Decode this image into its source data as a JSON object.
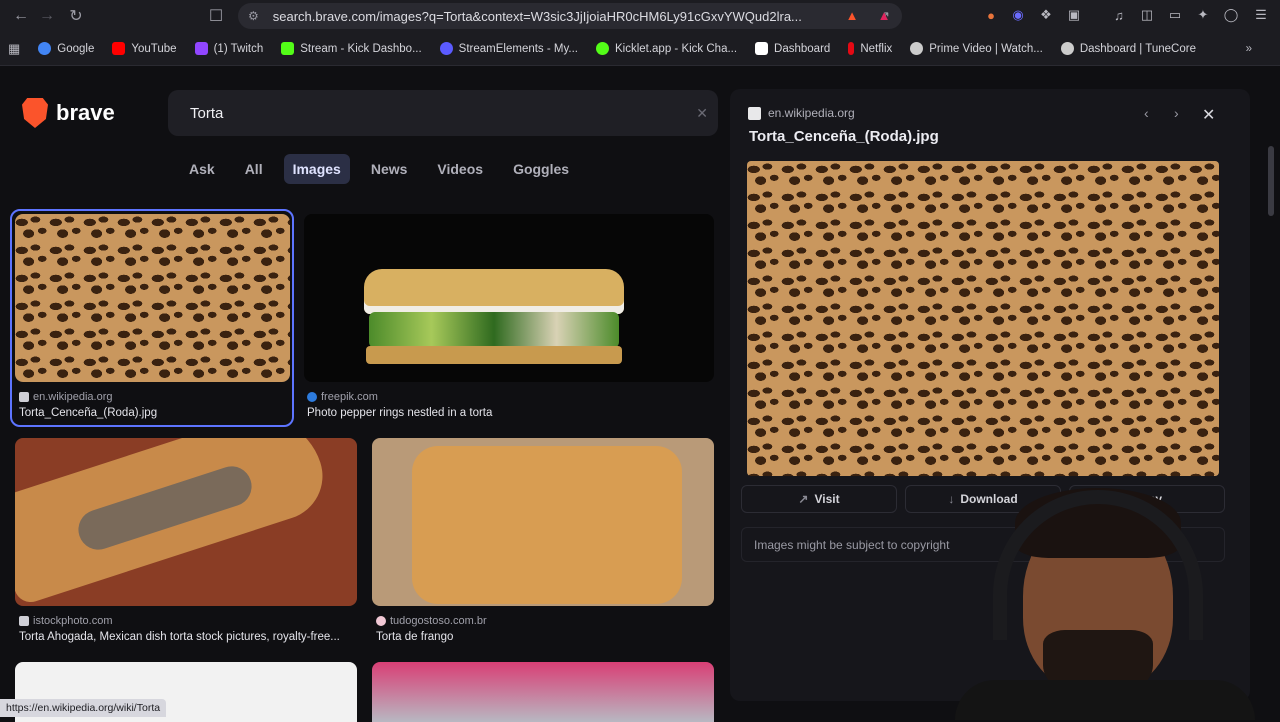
{
  "browser": {
    "url": "search.brave.com/images?q=Torta&context=W3sic3JjIjoiaHR0cHM6Ly91cGxvYWQud2lra...",
    "bookmarks": [
      {
        "label": "Google",
        "color": "#4285f4"
      },
      {
        "label": "YouTube",
        "color": "#ff0000"
      },
      {
        "label": "(1) Twitch",
        "color": "#9146ff"
      },
      {
        "label": "Stream - Kick Dashbo...",
        "color": "#53fc18"
      },
      {
        "label": "StreamElements - My...",
        "color": "#5b5bff"
      },
      {
        "label": "Kicklet.app - Kick Cha...",
        "color": "#53fc18"
      },
      {
        "label": "Dashboard",
        "color": "#ffffff"
      },
      {
        "label": "Netflix",
        "color": "#e50914"
      },
      {
        "label": "Prime Video | Watch...",
        "color": "#cccccc"
      },
      {
        "label": "Dashboard | TuneCore",
        "color": "#cccccc"
      }
    ]
  },
  "brand": {
    "name": "brave",
    "accent": "#fb542b"
  },
  "search": {
    "query": "Torta"
  },
  "tabs": [
    "Ask",
    "All",
    "Images",
    "News",
    "Videos",
    "Goggles"
  ],
  "results": [
    {
      "source": "en.wikipedia.org",
      "caption": "Torta_Cenceña_(Roda).jpg"
    },
    {
      "source": "freepik.com",
      "caption": "Photo pepper rings nestled in a torta"
    },
    {
      "source": "istockphoto.com",
      "caption": "Torta Ahogada, Mexican dish torta stock pictures, royalty-free..."
    },
    {
      "source": "tudogostoso.com.br",
      "caption": "Torta de frango"
    }
  ],
  "panel": {
    "source": "en.wikipedia.org",
    "title": "Torta_Cenceña_(Roda).jpg",
    "visit_label": "Visit",
    "download_label": "Download",
    "copy_label": "Copy",
    "copyright_note": "Images might be subject to copyright"
  },
  "status_url": "https://en.wikipedia.org/wiki/Torta"
}
